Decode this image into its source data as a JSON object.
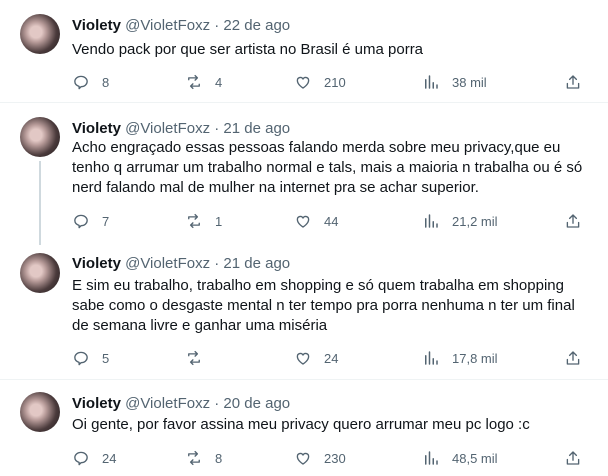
{
  "tweets": [
    {
      "name": "Violety",
      "handle": "@VioletFoxz",
      "date": "22 de ago",
      "text": "Vendo pack por que ser artista no Brasil é uma porra",
      "replies": "8",
      "retweets": "4",
      "likes": "210",
      "views": "38 mil"
    },
    {
      "name": "Violety",
      "handle": "@VioletFoxz",
      "date": "21 de ago",
      "text": "Acho engraçado essas  pessoas falando merda sobre meu privacy,que eu tenho q arrumar um trabalho  normal e tals, mais a maioria n trabalha ou é só nerd falando mal de mulher na internet pra se achar superior.",
      "replies": "7",
      "retweets": "1",
      "likes": "44",
      "views": "21,2 mil"
    },
    {
      "name": "Violety",
      "handle": "@VioletFoxz",
      "date": "21 de ago",
      "text": "E sim eu trabalho, trabalho em shopping e só quem trabalha em shopping sabe como o desgaste mental n ter tempo pra porra nenhuma n ter um final de semana livre e ganhar uma miséria",
      "replies": "5",
      "retweets": "",
      "likes": "24",
      "views": "17,8 mil"
    },
    {
      "name": "Violety",
      "handle": "@VioletFoxz",
      "date": "20 de ago",
      "text": "Oi gente, por favor assina meu privacy quero arrumar meu pc logo :c",
      "replies": "24",
      "retweets": "8",
      "likes": "230",
      "views": "48,5 mil"
    }
  ],
  "separator": "·",
  "icons": [
    "reply-icon",
    "retweet-icon",
    "like-icon",
    "views-icon",
    "share-icon"
  ],
  "colors": {
    "text": "#0f1419",
    "muted": "#536471",
    "divider": "#eff3f4",
    "thread": "#cfd9de"
  }
}
